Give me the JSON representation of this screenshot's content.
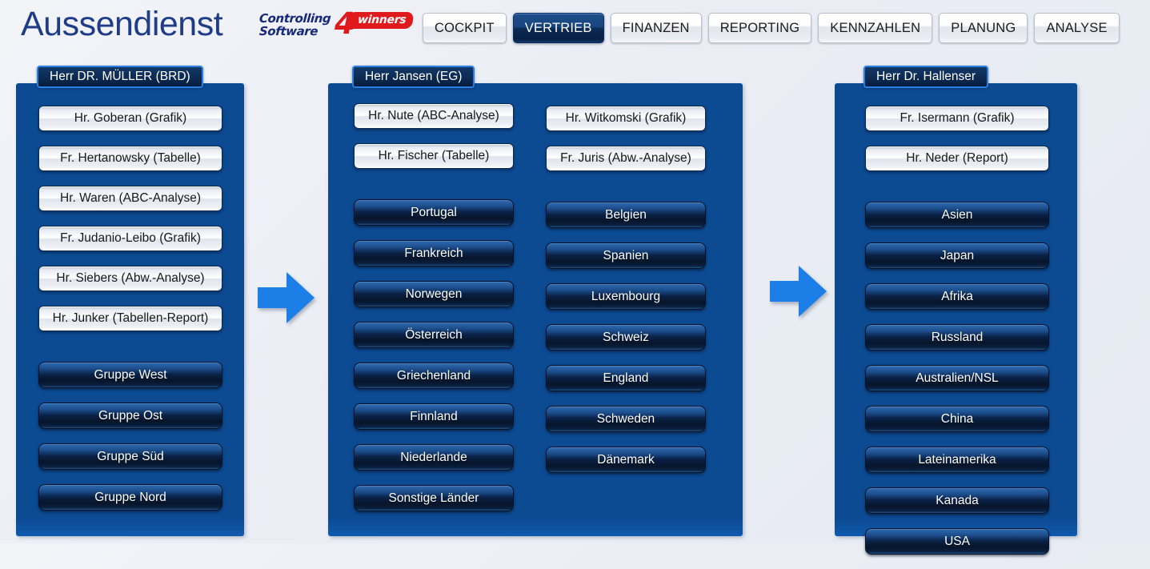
{
  "header": {
    "app_title": "Aussendienst",
    "logo": {
      "line1": "Controlling",
      "line2": "Software",
      "number": "4",
      "pill": "winners"
    },
    "nav_tabs": [
      {
        "label": "COCKPIT",
        "active": false
      },
      {
        "label": "VERTRIEB",
        "active": true
      },
      {
        "label": "FINANZEN",
        "active": false
      },
      {
        "label": "REPORTING",
        "active": false
      },
      {
        "label": "KENNZAHLEN",
        "active": false
      },
      {
        "label": "PLANUNG",
        "active": false
      },
      {
        "label": "ANALYSE",
        "active": false
      }
    ]
  },
  "colors": {
    "panel_blue": "#0c4a92",
    "accent_blue": "#1c7fe8",
    "title_blue": "#1f3c86",
    "logo_red": "#e0191d",
    "active_tab_navy": "#0b2b55"
  },
  "panels": [
    {
      "id": "panel-mueller",
      "tab_label": "Herr DR. MÜLLER (BRD)",
      "columns": [
        {
          "light_buttons": [
            "Hr. Goberan (Grafik)",
            "Fr. Hertanowsky (Tabelle)",
            "Hr. Waren (ABC-Analyse)",
            "Fr. Judanio-Leibo (Grafik)",
            "Hr. Siebers (Abw.-Analyse)",
            "Hr. Junker (Tabellen-Report)"
          ],
          "dark_buttons": [
            "Gruppe West",
            "Gruppe Ost",
            "Gruppe Süd",
            "Gruppe Nord"
          ]
        }
      ]
    },
    {
      "id": "panel-jansen",
      "tab_label": "Herr Jansen (EG)",
      "columns": [
        {
          "light_buttons": [
            "Hr. Nute (ABC-Analyse)",
            "Hr. Fischer (Tabelle)"
          ],
          "dark_buttons": [
            "Portugal",
            "Frankreich",
            "Norwegen",
            "Österreich",
            "Griechenland",
            "Finnland",
            "Niederlande",
            "Sonstige Länder"
          ]
        },
        {
          "light_buttons": [
            "Hr. Witkomski (Grafik)",
            "Fr. Juris (Abw.-Analyse)"
          ],
          "dark_buttons": [
            "Belgien",
            "Spanien",
            "Luxembourg",
            "Schweiz",
            "England",
            "Schweden",
            "Dänemark"
          ]
        }
      ]
    },
    {
      "id": "panel-hallenser",
      "tab_label": "Herr Dr. Hallenser",
      "columns": [
        {
          "light_buttons": [
            "Fr. Isermann (Grafik)",
            "Hr. Neder (Report)"
          ],
          "dark_buttons": [
            "Asien",
            "Japan",
            "Afrika",
            "Russland",
            "Australien/NSL",
            "China",
            "Lateinamerika",
            "Kanada",
            "USA"
          ]
        }
      ]
    }
  ],
  "arrows": [
    {
      "name": "arrow-mueller-to-jansen",
      "direction": "right"
    },
    {
      "name": "arrow-jansen-to-hallenser",
      "direction": "right"
    }
  ]
}
